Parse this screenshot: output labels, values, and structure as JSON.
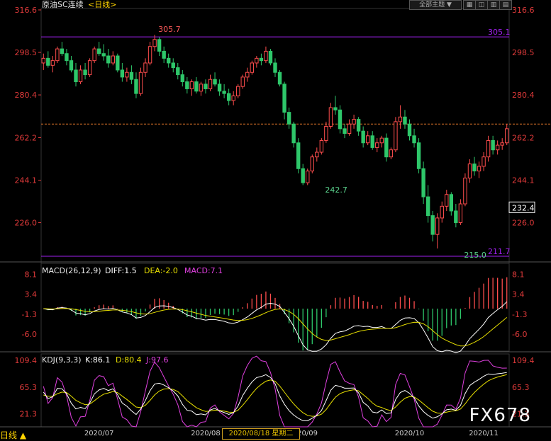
{
  "header": {
    "title": "原油SC连续",
    "period": "<日线>"
  },
  "toolbar": {
    "select_label": "全部主题",
    "select_arrow": "▼"
  },
  "macd_header": {
    "name": "MACD(26,12,9)",
    "diff": "DIFF:1.5",
    "dea": "DEA:-2.0",
    "macd": "MACD:7.1"
  },
  "kdj_header": {
    "name": "KDJ(9,3,3)",
    "k": "K:86.1",
    "d": "D:80.4",
    "j": "J:97.6"
  },
  "footer": {
    "period_button": "日线 ▲",
    "cursor_date": "2020/08/18 星期二",
    "watermark": "FX678"
  },
  "colors": {
    "up": "#ff4d4d",
    "down": "#2ec76a",
    "purple": "#a020f0",
    "axis": "#e03a3a",
    "dea": "#e8e000",
    "macd": "#e040e0",
    "bg": "#000000"
  },
  "chart_data": [
    {
      "type": "candlestick",
      "panel": "price",
      "ylim": [
        211.7,
        316.6
      ],
      "yticks": [
        "316.6",
        "298.5",
        "280.4",
        "262.2",
        "244.1",
        "226.0"
      ],
      "xticks": [
        {
          "label": "2020/07",
          "index": 12
        },
        {
          "label": "2020/08",
          "index": 35
        },
        {
          "label": "2020/09",
          "index": 56
        },
        {
          "label": "2020/10",
          "index": 79
        },
        {
          "label": "2020/11",
          "index": 95
        }
      ],
      "hlines": [
        {
          "value": 305.1,
          "label": "305.1",
          "color": "#a020f0"
        },
        {
          "value": 211.7,
          "label": "211.7",
          "color": "#a020f0"
        },
        {
          "value": 268.0,
          "dashed": true,
          "color": "#e0742a"
        }
      ],
      "current_price": "232.4",
      "annotations": [
        {
          "index": 24,
          "value": 305.7,
          "text": "305.7",
          "color": "#ff5a5a"
        },
        {
          "index": 60,
          "value": 242.7,
          "text": "242.7",
          "color": "#5ad28c"
        },
        {
          "index": 90,
          "value": 215.0,
          "text": "215.0",
          "color": "#5ad28c"
        }
      ],
      "ohlc": [
        [
          294,
          298,
          291,
          296
        ],
        [
          296,
          299,
          292,
          293
        ],
        [
          293,
          297,
          290,
          295
        ],
        [
          295,
          301,
          294,
          300
        ],
        [
          300,
          303,
          297,
          298
        ],
        [
          298,
          300,
          293,
          295
        ],
        [
          295,
          297,
          290,
          291
        ],
        [
          291,
          294,
          284,
          286
        ],
        [
          286,
          293,
          285,
          291
        ],
        [
          291,
          294,
          287,
          289
        ],
        [
          289,
          296,
          288,
          295
        ],
        [
          295,
          301,
          294,
          300
        ],
        [
          300,
          303,
          297,
          298
        ],
        [
          298,
          302,
          295,
          297
        ],
        [
          297,
          300,
          292,
          294
        ],
        [
          294,
          299,
          293,
          297
        ],
        [
          297,
          298,
          290,
          291
        ],
        [
          291,
          294,
          286,
          288
        ],
        [
          288,
          292,
          286,
          290
        ],
        [
          290,
          293,
          285,
          287
        ],
        [
          287,
          290,
          279,
          281
        ],
        [
          281,
          292,
          280,
          290
        ],
        [
          290,
          296,
          288,
          294
        ],
        [
          294,
          303,
          293,
          301
        ],
        [
          301,
          306,
          299,
          304
        ],
        [
          304,
          305,
          297,
          299
        ],
        [
          299,
          301,
          294,
          296
        ],
        [
          296,
          298,
          292,
          294
        ],
        [
          294,
          296,
          290,
          292
        ],
        [
          292,
          294,
          287,
          289
        ],
        [
          289,
          291,
          284,
          286
        ],
        [
          286,
          288,
          281,
          283
        ],
        [
          283,
          287,
          280,
          286
        ],
        [
          286,
          288,
          281,
          282
        ],
        [
          282,
          286,
          280,
          285
        ],
        [
          285,
          287,
          281,
          283
        ],
        [
          283,
          289,
          282,
          287
        ],
        [
          287,
          290,
          284,
          285
        ],
        [
          285,
          287,
          280,
          282
        ],
        [
          282,
          285,
          279,
          281
        ],
        [
          281,
          283,
          276,
          278
        ],
        [
          278,
          282,
          276,
          280
        ],
        [
          280,
          285,
          279,
          284
        ],
        [
          284,
          289,
          283,
          288
        ],
        [
          288,
          292,
          286,
          290
        ],
        [
          290,
          295,
          289,
          294
        ],
        [
          294,
          297,
          292,
          296
        ],
        [
          296,
          298,
          293,
          295
        ],
        [
          295,
          301,
          294,
          299
        ],
        [
          299,
          300,
          293,
          294
        ],
        [
          294,
          296,
          288,
          290
        ],
        [
          290,
          291,
          284,
          285
        ],
        [
          285,
          286,
          270,
          273
        ],
        [
          273,
          275,
          266,
          268
        ],
        [
          268,
          269,
          258,
          260
        ],
        [
          260,
          262,
          247,
          249
        ],
        [
          249,
          251,
          242,
          243
        ],
        [
          243,
          249,
          242,
          248
        ],
        [
          248,
          255,
          247,
          254
        ],
        [
          254,
          258,
          252,
          256
        ],
        [
          256,
          262,
          255,
          261
        ],
        [
          261,
          269,
          260,
          267
        ],
        [
          267,
          277,
          266,
          275
        ],
        [
          275,
          280,
          272,
          274
        ],
        [
          274,
          276,
          264,
          266
        ],
        [
          266,
          268,
          262,
          264
        ],
        [
          264,
          270,
          263,
          268
        ],
        [
          268,
          272,
          266,
          270
        ],
        [
          270,
          271,
          263,
          265
        ],
        [
          265,
          267,
          258,
          260
        ],
        [
          260,
          265,
          259,
          263
        ],
        [
          263,
          265,
          257,
          258
        ],
        [
          258,
          262,
          256,
          260
        ],
        [
          260,
          263,
          258,
          262
        ],
        [
          262,
          264,
          252,
          254
        ],
        [
          254,
          258,
          253,
          257
        ],
        [
          257,
          271,
          256,
          269
        ],
        [
          269,
          276,
          266,
          271
        ],
        [
          271,
          274,
          266,
          268
        ],
        [
          268,
          270,
          261,
          263
        ],
        [
          263,
          266,
          258,
          260
        ],
        [
          260,
          262,
          247,
          249
        ],
        [
          249,
          252,
          234,
          237
        ],
        [
          237,
          242,
          226,
          229
        ],
        [
          229,
          231,
          218,
          221
        ],
        [
          221,
          230,
          215,
          228
        ],
        [
          228,
          235,
          226,
          233
        ],
        [
          233,
          240,
          231,
          238
        ],
        [
          238,
          239,
          229,
          231
        ],
        [
          231,
          234,
          224,
          226
        ],
        [
          226,
          236,
          225,
          234
        ],
        [
          234,
          247,
          233,
          245
        ],
        [
          245,
          253,
          243,
          251
        ],
        [
          251,
          254,
          246,
          248
        ],
        [
          248,
          252,
          245,
          250
        ],
        [
          250,
          256,
          248,
          254
        ],
        [
          254,
          263,
          252,
          261
        ],
        [
          261,
          263,
          255,
          257
        ],
        [
          257,
          261,
          255,
          259
        ],
        [
          259,
          262,
          257,
          260
        ],
        [
          260,
          268,
          259,
          266
        ]
      ]
    },
    {
      "type": "macd",
      "panel": "macd",
      "ylim": [
        -10,
        10
      ],
      "yticks": [
        "8.1",
        "3.4",
        "-1.3",
        "-6.0"
      ],
      "diff_last": 1.5,
      "dea_last": -2.0,
      "macd_last": 7.1
    },
    {
      "type": "kdj",
      "panel": "kdj",
      "ylim": [
        0,
        120
      ],
      "yticks": [
        "109.4",
        "65.3",
        "21.3"
      ],
      "k_last": 86.1,
      "d_last": 80.4,
      "j_last": 97.6
    }
  ]
}
